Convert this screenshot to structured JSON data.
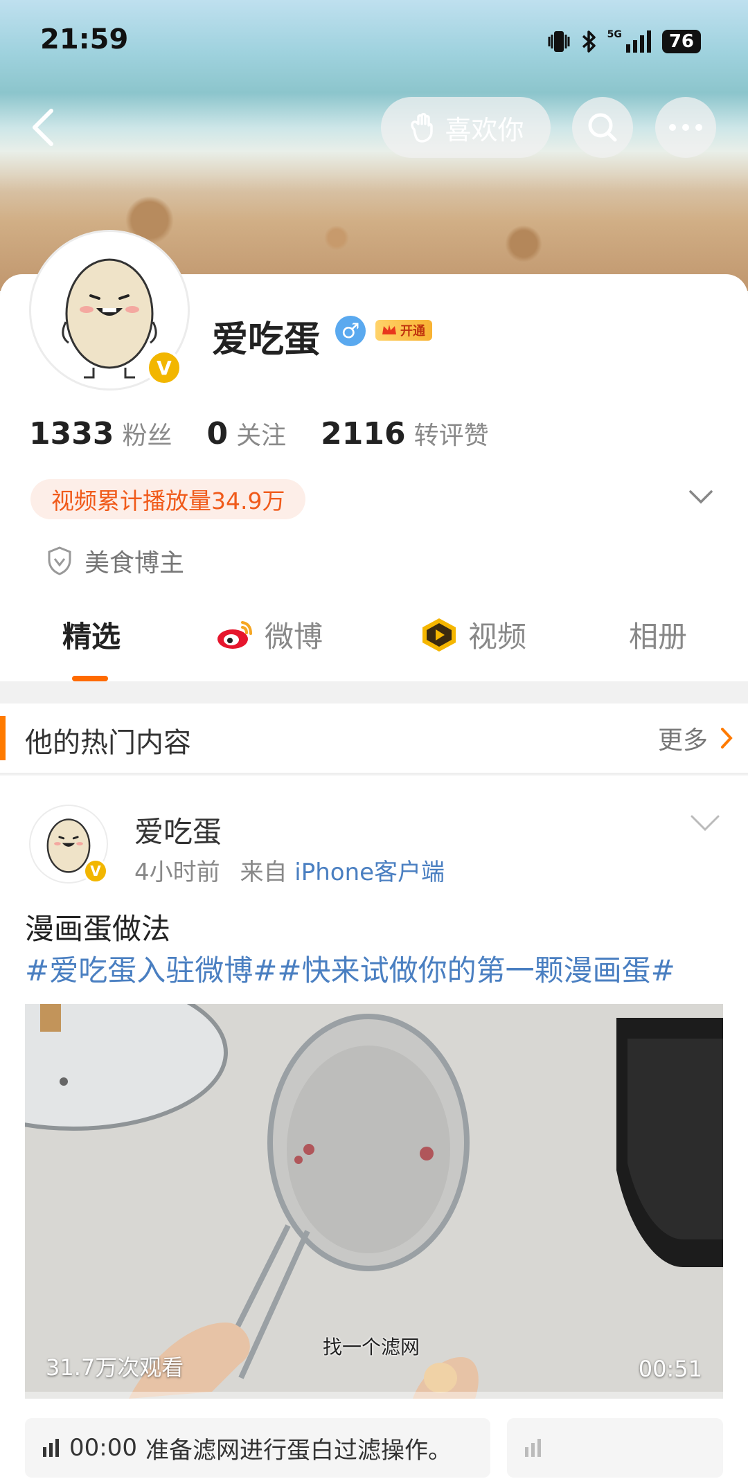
{
  "status_bar": {
    "time": "21:59",
    "network": "5G",
    "battery": "76"
  },
  "nav": {
    "like_label": "喜欢你",
    "icons": [
      "back-icon",
      "search-icon",
      "more-icon"
    ]
  },
  "profile": {
    "name": "爱吃蛋",
    "gender_symbol": "♂",
    "vip_label": "开通",
    "verified_badge": "V",
    "stats": [
      {
        "value": "1333",
        "label": "粉丝"
      },
      {
        "value": "0",
        "label": "关注"
      },
      {
        "value": "2116",
        "label": "转评赞"
      }
    ],
    "play_count": "视频累计播放量34.9万",
    "tagline": "美食博主"
  },
  "tabs": [
    {
      "label": "精选",
      "active": true
    },
    {
      "label": "微博",
      "icon": "weibo-icon"
    },
    {
      "label": "视频",
      "icon": "video-icon"
    },
    {
      "label": "相册"
    }
  ],
  "hot_section": {
    "title": "他的热门内容",
    "more": "更多"
  },
  "post": {
    "author": "爱吃蛋",
    "time": "4小时前",
    "from": "来自",
    "source": "iPhone客户端",
    "title": "漫画蛋做法",
    "tags": "#爱吃蛋入驻微博##快来试做你的第一颗漫画蛋#",
    "video": {
      "views": "31.7万次观看",
      "duration": "00:51",
      "subtitle": "找一个滤网"
    },
    "chapters": [
      {
        "time": "00:00",
        "text": "准备滤网进行蛋白过滤操作。"
      }
    ]
  },
  "colors": {
    "accent": "#ff6a00",
    "link": "#4a7fc1",
    "vip": "#f8b232",
    "verified": "#f2b600"
  }
}
